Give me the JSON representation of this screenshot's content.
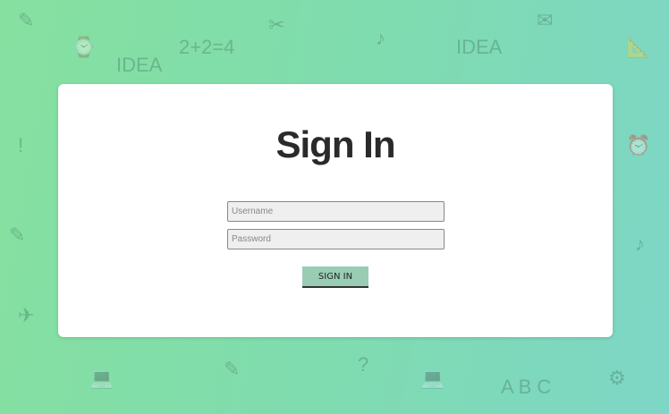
{
  "form": {
    "title": "Sign In",
    "username_placeholder": "Username",
    "password_placeholder": "Password",
    "submit_label": "SIGN IN"
  }
}
